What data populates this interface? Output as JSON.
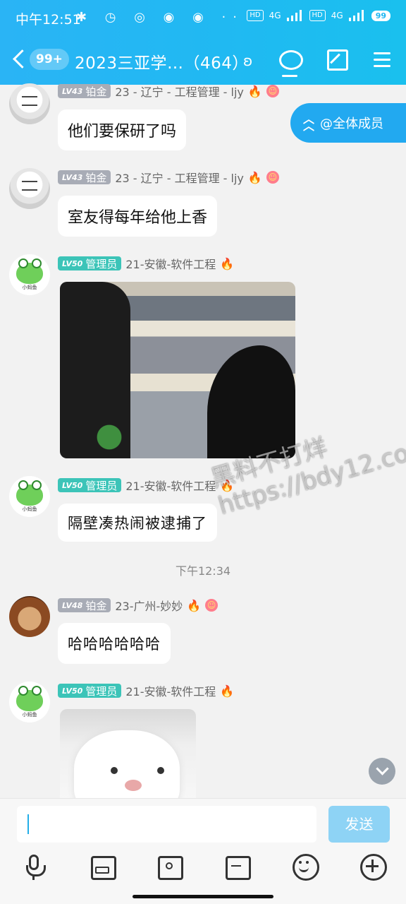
{
  "status": {
    "time": "中午12:51",
    "icons_text": "✱ ◷ ◎ ◉ ◉ ··",
    "hd1": "HD",
    "net1": "4G",
    "hd2": "HD",
    "net2": "4G",
    "battery": "99"
  },
  "header": {
    "unread_badge": "99+",
    "title": "2023三亚学…（464）",
    "ear_icon": "ʚ"
  },
  "mention_button": {
    "label": "@全体成员"
  },
  "messages": [
    {
      "level": "LV43",
      "role": "铂金",
      "name": "23 - 辽宁 - 工程管理 - ljy",
      "text": "他们要保研了吗"
    },
    {
      "level": "LV43",
      "role": "铂金",
      "name": "23 - 辽宁 - 工程管理 - ljy",
      "text": "室友得每年给他上香"
    },
    {
      "level": "LV50",
      "role": "管理员",
      "name": "21-安徽-软件工程",
      "avatar_caption": "小蚂鱼"
    },
    {
      "level": "LV50",
      "role": "管理员",
      "name": "21-安徽-软件工程",
      "avatar_caption": "小蚂鱼",
      "text": "隔壁凑热闹被逮捕了"
    },
    {
      "level": "LV48",
      "role": "铂金",
      "name": "23-广州-妙妙",
      "text": "哈哈哈哈哈哈"
    },
    {
      "level": "LV50",
      "role": "管理员",
      "name": "21-安徽-软件工程",
      "avatar_caption": "小蚂鱼"
    }
  ],
  "timestamp": "下午12:34",
  "watermark": "黑料不打烊 https://bdy12.co",
  "input": {
    "send_label": "发送"
  },
  "toolbar": [
    "mic-icon",
    "photo-icon",
    "camera-icon",
    "red-packet-icon",
    "emoji-icon",
    "plus-icon"
  ],
  "colors": {
    "header": "#20b9f2",
    "mention": "#22a9f0",
    "admin_badge": "#3cc4b8",
    "platinum_badge": "#a8acb6",
    "send_disabled": "#8ed3f5"
  }
}
